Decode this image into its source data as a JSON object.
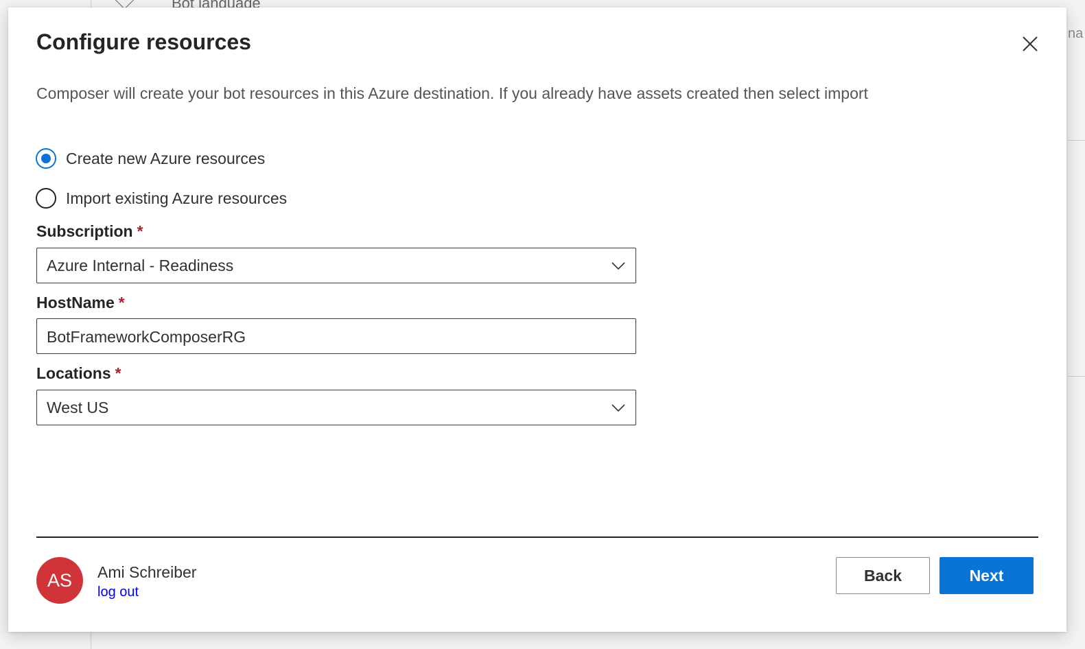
{
  "background": {
    "partial_text": "Bot language",
    "edge_text": "na"
  },
  "dialog": {
    "title": "Configure resources",
    "subtitle": "Composer will create your bot resources in this Azure destination. If you already have assets created then select import",
    "close_icon": "close-icon"
  },
  "options": [
    {
      "label": "Create new Azure resources",
      "checked": true
    },
    {
      "label": "Import existing Azure resources",
      "checked": false
    }
  ],
  "fields": {
    "subscription": {
      "label": "Subscription",
      "required": "*",
      "value": "Azure Internal - Readiness"
    },
    "hostname": {
      "label": "HostName",
      "required": "*",
      "value": "BotFrameworkComposerRG"
    },
    "locations": {
      "label": "Locations",
      "required": "*",
      "value": "West US"
    }
  },
  "footer": {
    "avatar_initials": "AS",
    "user_name": "Ami Schreiber",
    "logout_label": "log out",
    "back_label": "Back",
    "next_label": "Next"
  },
  "colors": {
    "accent": "#0a74d6",
    "avatar": "#d13438",
    "required": "#a4262c"
  }
}
